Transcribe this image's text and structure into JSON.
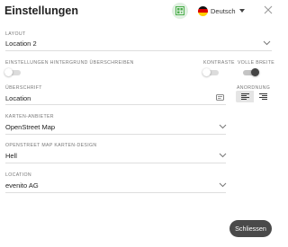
{
  "header": {
    "title": "Einstellungen",
    "language": "Deutsch",
    "accent_color": "#5cb85c"
  },
  "layout": {
    "label": "LAYOUT",
    "value": "Location 2"
  },
  "toggles": {
    "background_override": {
      "label": "EINSTELLUNGEN HINTERGRUND ÜBERSCHREIBEN",
      "on": false
    },
    "contrast": {
      "label": "KONTRASTE",
      "on": false
    },
    "full_width": {
      "label": "VOLLE BREITE",
      "on": true
    }
  },
  "heading": {
    "label": "ÜBERSCHRIFT",
    "value": "Location"
  },
  "alignment": {
    "label": "ANORDNUNG",
    "selected": "left"
  },
  "map_provider": {
    "label": "KARTEN-ANBIETER",
    "value": "OpenStreet Map"
  },
  "map_design": {
    "label": "OPENSTREET MAP KARTEN-DESIGN",
    "value": "Hell"
  },
  "location": {
    "label": "LOCATION",
    "value": "evenito AG"
  },
  "footer": {
    "close_label": "Schliessen"
  }
}
